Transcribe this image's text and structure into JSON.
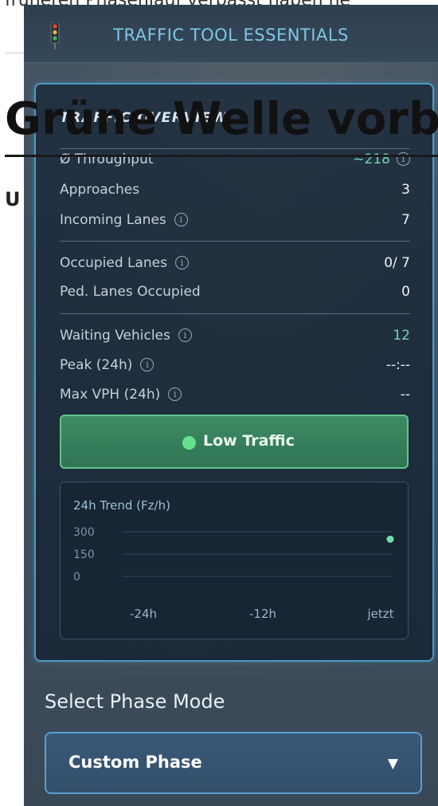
{
  "article": {
    "top_text": "früheren Phasenlauf verpasst haben ne",
    "heading": "Grüne Welle vorb",
    "subheading": "U"
  },
  "panel": {
    "title": "TRAFFIC TOOL ESSENTIALS",
    "icon": "traffic-light-icon"
  },
  "overview": {
    "title": "TRAFFIC OVERVIEW",
    "rows": [
      {
        "label": "Ø Throughput",
        "value": "~218",
        "info": true,
        "value_info": true,
        "highlight": true
      },
      {
        "label": "Approaches",
        "value": "3",
        "info": false
      },
      {
        "label": "Incoming Lanes",
        "value": "7",
        "info": true
      },
      {
        "label": "Occupied Lanes",
        "value": "0/ 7",
        "info": true
      },
      {
        "label": "Ped. Lanes Occupied",
        "value": "0",
        "info": false
      },
      {
        "label": "Waiting Vehicles",
        "value": "12",
        "info": true,
        "highlight": true
      },
      {
        "label": "Peak (24h)",
        "value": "--:--",
        "info": true
      },
      {
        "label": "Max VPH (24h)",
        "value": "--",
        "info": true
      }
    ]
  },
  "status": {
    "label": "Low Traffic",
    "color": "#66e08f"
  },
  "chart_data": {
    "type": "scatter",
    "title": "24h Trend (Fz/h)",
    "x": [
      "jetzt"
    ],
    "y": [
      250
    ],
    "x_tick_labels": [
      "-24h",
      "-12h",
      "jetzt"
    ],
    "y_tick_labels": [
      "300",
      "150",
      "0"
    ],
    "ylim": [
      0,
      300
    ],
    "grid": true,
    "point_color": "#6fe0a8"
  },
  "phase": {
    "label": "Select Phase Mode",
    "selected": "Custom Phase",
    "caret": "▼"
  },
  "colors": {
    "accent": "#4a9bc7",
    "title": "#7fc6e4",
    "green": "#6fd8b4"
  }
}
